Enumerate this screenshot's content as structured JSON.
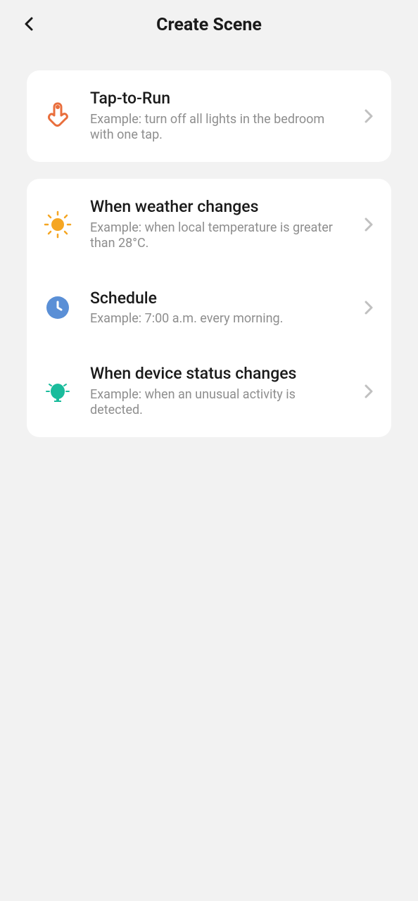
{
  "header": {
    "title": "Create Scene"
  },
  "groups": [
    {
      "items": [
        {
          "icon": "tap",
          "title": "Tap-to-Run",
          "subtitle": "Example: turn off all lights in the bedroom with one tap."
        }
      ]
    },
    {
      "items": [
        {
          "icon": "sun",
          "title": "When weather changes",
          "subtitle": "Example: when local temperature is greater than 28°C."
        },
        {
          "icon": "clock",
          "title": "Schedule",
          "subtitle": "Example: 7:00 a.m. every morning."
        },
        {
          "icon": "device",
          "title": "When device status changes",
          "subtitle": "Example: when an unusual activity is detected."
        }
      ]
    }
  ]
}
